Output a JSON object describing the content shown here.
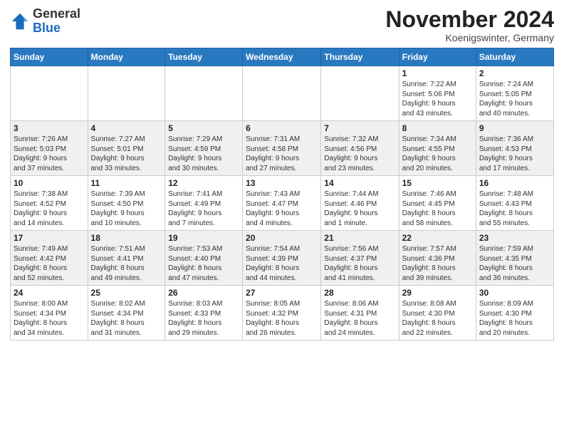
{
  "header": {
    "logo_general": "General",
    "logo_blue": "Blue",
    "month_title": "November 2024",
    "location": "Koenigswinter, Germany"
  },
  "weekdays": [
    "Sunday",
    "Monday",
    "Tuesday",
    "Wednesday",
    "Thursday",
    "Friday",
    "Saturday"
  ],
  "rows": [
    {
      "row_class": "row-odd",
      "cells": [
        {
          "day": "",
          "info": ""
        },
        {
          "day": "",
          "info": ""
        },
        {
          "day": "",
          "info": ""
        },
        {
          "day": "",
          "info": ""
        },
        {
          "day": "",
          "info": ""
        },
        {
          "day": "1",
          "info": "Sunrise: 7:22 AM\nSunset: 5:06 PM\nDaylight: 9 hours\nand 43 minutes."
        },
        {
          "day": "2",
          "info": "Sunrise: 7:24 AM\nSunset: 5:05 PM\nDaylight: 9 hours\nand 40 minutes."
        }
      ]
    },
    {
      "row_class": "row-even",
      "cells": [
        {
          "day": "3",
          "info": "Sunrise: 7:26 AM\nSunset: 5:03 PM\nDaylight: 9 hours\nand 37 minutes."
        },
        {
          "day": "4",
          "info": "Sunrise: 7:27 AM\nSunset: 5:01 PM\nDaylight: 9 hours\nand 33 minutes."
        },
        {
          "day": "5",
          "info": "Sunrise: 7:29 AM\nSunset: 4:59 PM\nDaylight: 9 hours\nand 30 minutes."
        },
        {
          "day": "6",
          "info": "Sunrise: 7:31 AM\nSunset: 4:58 PM\nDaylight: 9 hours\nand 27 minutes."
        },
        {
          "day": "7",
          "info": "Sunrise: 7:32 AM\nSunset: 4:56 PM\nDaylight: 9 hours\nand 23 minutes."
        },
        {
          "day": "8",
          "info": "Sunrise: 7:34 AM\nSunset: 4:55 PM\nDaylight: 9 hours\nand 20 minutes."
        },
        {
          "day": "9",
          "info": "Sunrise: 7:36 AM\nSunset: 4:53 PM\nDaylight: 9 hours\nand 17 minutes."
        }
      ]
    },
    {
      "row_class": "row-odd",
      "cells": [
        {
          "day": "10",
          "info": "Sunrise: 7:38 AM\nSunset: 4:52 PM\nDaylight: 9 hours\nand 14 minutes."
        },
        {
          "day": "11",
          "info": "Sunrise: 7:39 AM\nSunset: 4:50 PM\nDaylight: 9 hours\nand 10 minutes."
        },
        {
          "day": "12",
          "info": "Sunrise: 7:41 AM\nSunset: 4:49 PM\nDaylight: 9 hours\nand 7 minutes."
        },
        {
          "day": "13",
          "info": "Sunrise: 7:43 AM\nSunset: 4:47 PM\nDaylight: 9 hours\nand 4 minutes."
        },
        {
          "day": "14",
          "info": "Sunrise: 7:44 AM\nSunset: 4:46 PM\nDaylight: 9 hours\nand 1 minute."
        },
        {
          "day": "15",
          "info": "Sunrise: 7:46 AM\nSunset: 4:45 PM\nDaylight: 8 hours\nand 58 minutes."
        },
        {
          "day": "16",
          "info": "Sunrise: 7:48 AM\nSunset: 4:43 PM\nDaylight: 8 hours\nand 55 minutes."
        }
      ]
    },
    {
      "row_class": "row-even",
      "cells": [
        {
          "day": "17",
          "info": "Sunrise: 7:49 AM\nSunset: 4:42 PM\nDaylight: 8 hours\nand 52 minutes."
        },
        {
          "day": "18",
          "info": "Sunrise: 7:51 AM\nSunset: 4:41 PM\nDaylight: 8 hours\nand 49 minutes."
        },
        {
          "day": "19",
          "info": "Sunrise: 7:53 AM\nSunset: 4:40 PM\nDaylight: 8 hours\nand 47 minutes."
        },
        {
          "day": "20",
          "info": "Sunrise: 7:54 AM\nSunset: 4:39 PM\nDaylight: 8 hours\nand 44 minutes."
        },
        {
          "day": "21",
          "info": "Sunrise: 7:56 AM\nSunset: 4:37 PM\nDaylight: 8 hours\nand 41 minutes."
        },
        {
          "day": "22",
          "info": "Sunrise: 7:57 AM\nSunset: 4:36 PM\nDaylight: 8 hours\nand 39 minutes."
        },
        {
          "day": "23",
          "info": "Sunrise: 7:59 AM\nSunset: 4:35 PM\nDaylight: 8 hours\nand 36 minutes."
        }
      ]
    },
    {
      "row_class": "row-odd",
      "cells": [
        {
          "day": "24",
          "info": "Sunrise: 8:00 AM\nSunset: 4:34 PM\nDaylight: 8 hours\nand 34 minutes."
        },
        {
          "day": "25",
          "info": "Sunrise: 8:02 AM\nSunset: 4:34 PM\nDaylight: 8 hours\nand 31 minutes."
        },
        {
          "day": "26",
          "info": "Sunrise: 8:03 AM\nSunset: 4:33 PM\nDaylight: 8 hours\nand 29 minutes."
        },
        {
          "day": "27",
          "info": "Sunrise: 8:05 AM\nSunset: 4:32 PM\nDaylight: 8 hours\nand 26 minutes."
        },
        {
          "day": "28",
          "info": "Sunrise: 8:06 AM\nSunset: 4:31 PM\nDaylight: 8 hours\nand 24 minutes."
        },
        {
          "day": "29",
          "info": "Sunrise: 8:08 AM\nSunset: 4:30 PM\nDaylight: 8 hours\nand 22 minutes."
        },
        {
          "day": "30",
          "info": "Sunrise: 8:09 AM\nSunset: 4:30 PM\nDaylight: 8 hours\nand 20 minutes."
        }
      ]
    }
  ]
}
